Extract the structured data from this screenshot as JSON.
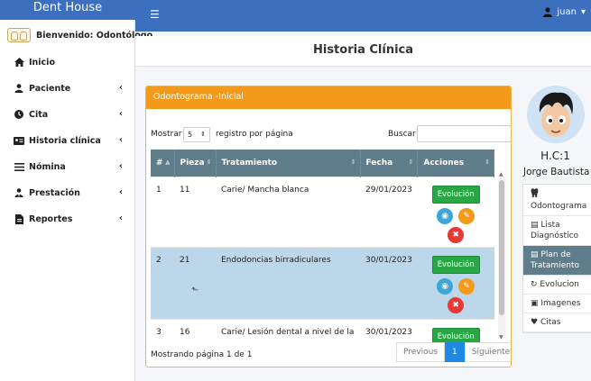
{
  "app": {
    "brand": "Dent House"
  },
  "topbar": {
    "menu_icon": "hamburger-icon",
    "user": "juan"
  },
  "sidebar": {
    "welcome": "Bienvenido: Odontólogo",
    "items": [
      {
        "label": "Inicio",
        "icon": "home-icon",
        "chevron": ""
      },
      {
        "label": "Paciente",
        "icon": "user-icon",
        "chevron": "‹"
      },
      {
        "label": "Cita",
        "icon": "clock-icon",
        "chevron": "‹"
      },
      {
        "label": "Historia clínica",
        "icon": "id-card-icon",
        "chevron": "‹"
      },
      {
        "label": "Nómina",
        "icon": "list-icon",
        "chevron": "‹"
      },
      {
        "label": "Prestación",
        "icon": "user-tie-icon",
        "chevron": "‹"
      },
      {
        "label": "Reportes",
        "icon": "file-icon",
        "chevron": "‹"
      }
    ]
  },
  "main": {
    "page_title": "Historia Clínica"
  },
  "panel": {
    "title": "Odontograma -Inicial",
    "show_label": "Mostrar",
    "page_length": "5",
    "per_page_label": "registro por página",
    "search_label": "Buscar",
    "search_value": "",
    "columns": [
      "#",
      "Pieza",
      "Tratamiento",
      "Fecha",
      "Acciones"
    ],
    "rows": [
      {
        "n": "1",
        "pieza": "11",
        "tratamiento": "Carie/ Mancha blanca",
        "fecha": "29/01/2023",
        "action": "Evolución"
      },
      {
        "n": "2",
        "pieza": "21",
        "tratamiento": "Endodoncias birradiculares",
        "fecha": "30/01/2023",
        "action": "Evolución"
      },
      {
        "n": "3",
        "pieza": "16",
        "tratamiento": "Carie/ Lesión dental a nivel de la",
        "fecha": "30/01/2023",
        "action": "Evolución"
      }
    ],
    "info": "Mostrando página 1 de 1",
    "pagination": {
      "previous": "Previous",
      "current": "1",
      "next": "Siguiente"
    }
  },
  "profile": {
    "hc": "H.C:1",
    "name": "Jorge Bautista",
    "menu": [
      {
        "label": "Odontograma",
        "icon": "tooth-icon"
      },
      {
        "label": "Lista Diagnóstico",
        "icon": "list-alt-icon"
      },
      {
        "label": "Plan de Tratamiento",
        "icon": "clipboard-icon"
      },
      {
        "label": "Evolucion",
        "icon": "sync-icon"
      },
      {
        "label": "Imagenes",
        "icon": "image-icon"
      },
      {
        "label": "Citas",
        "icon": "heart-icon"
      }
    ],
    "active_menu": "Plan de Tratamiento"
  },
  "colors": {
    "header": "#3c6fbe",
    "panel_head": "#f39a1b",
    "table_head": "#607d8b",
    "selected_row": "#bcd7ea",
    "success": "#28a745"
  }
}
